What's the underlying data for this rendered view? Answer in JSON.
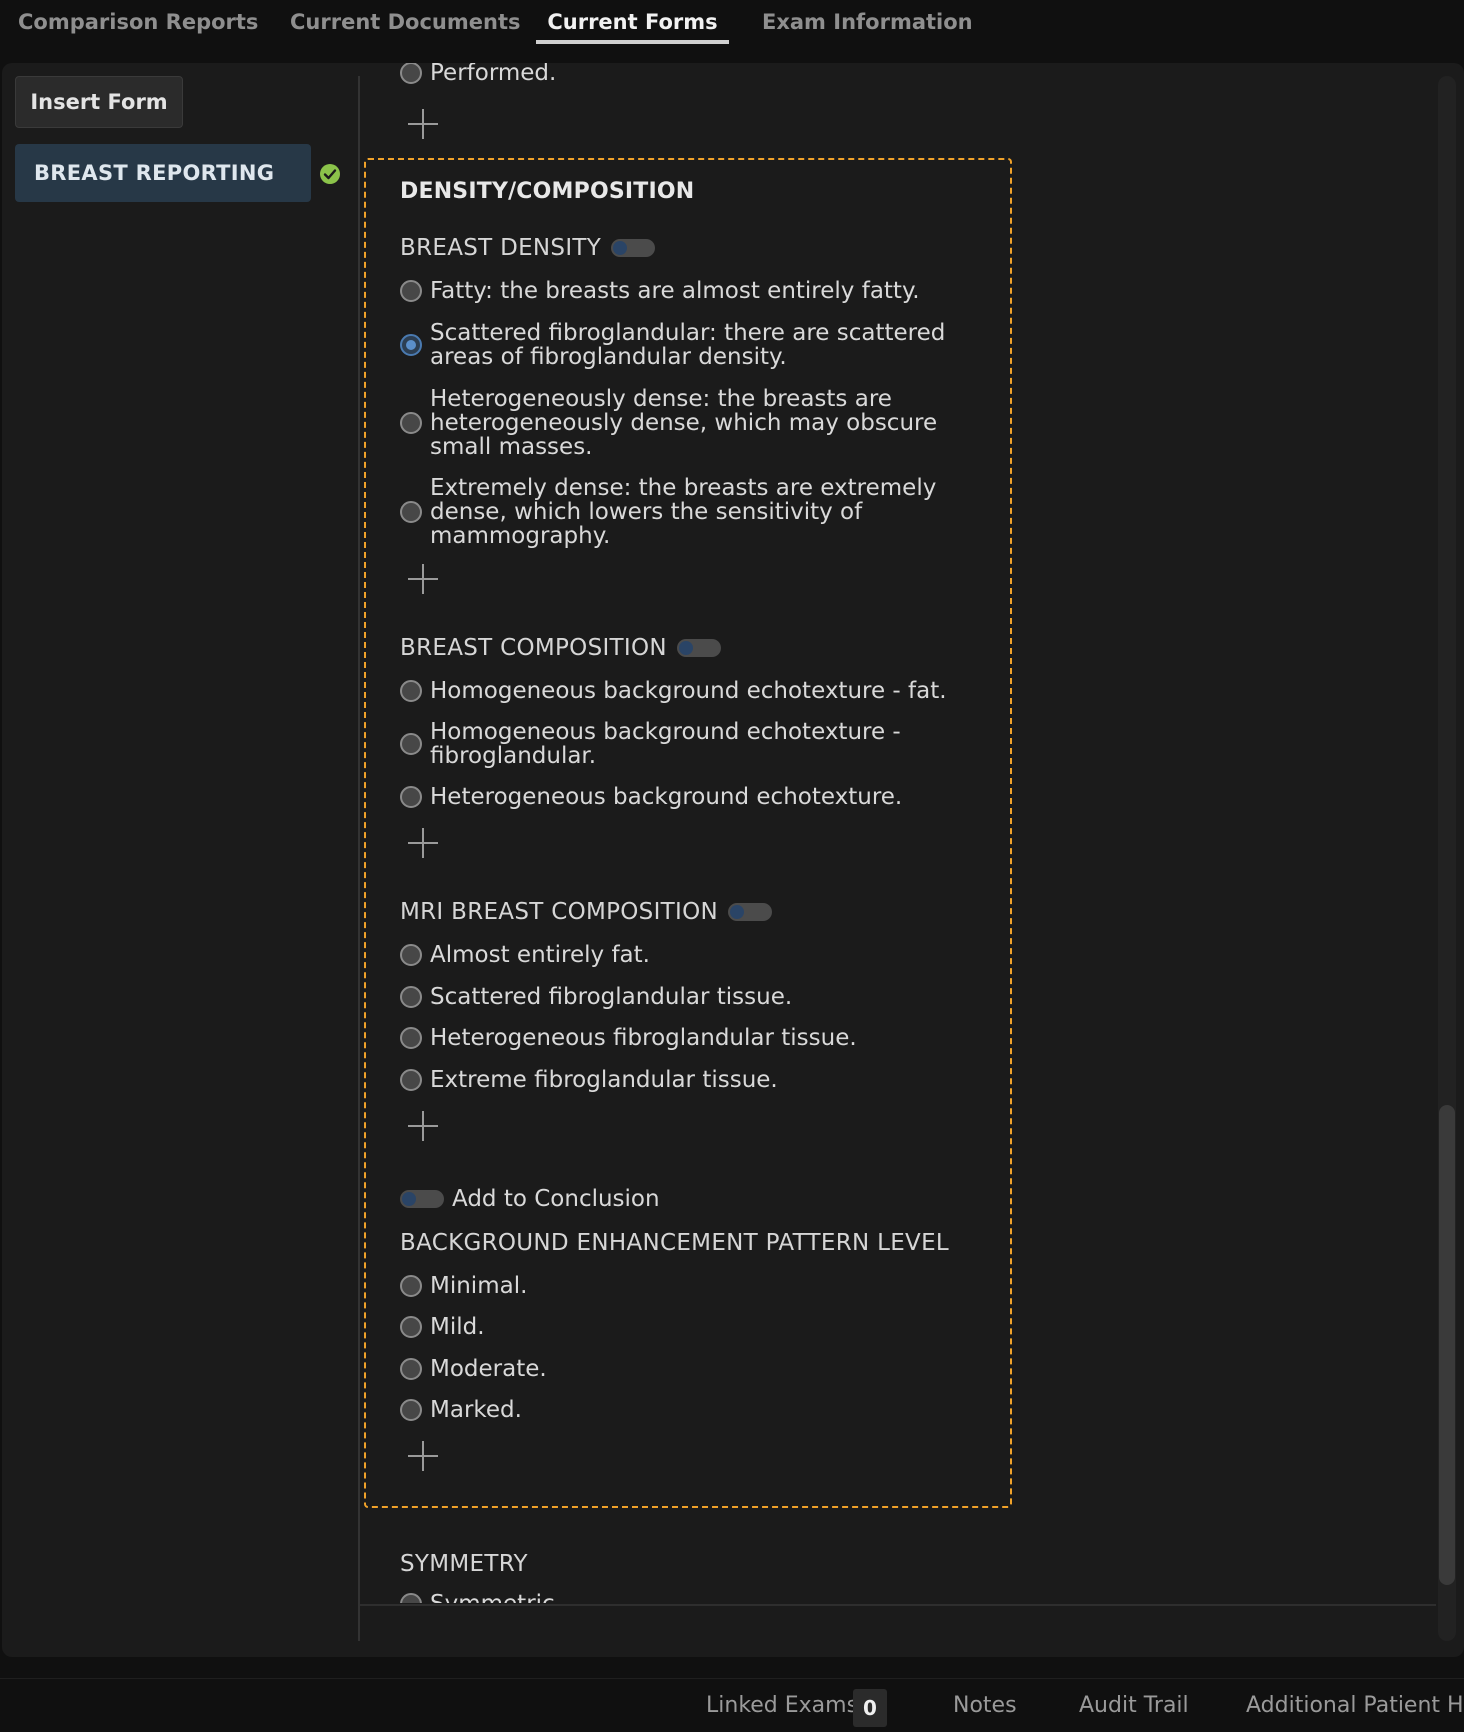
{
  "tabs": [
    {
      "label": "Comparison Reports",
      "active": false
    },
    {
      "label": "Current Documents",
      "active": false
    },
    {
      "label": "Current Forms",
      "active": true
    },
    {
      "label": "Exam Information",
      "active": false
    }
  ],
  "sidebar": {
    "insert_form_label": "Insert Form",
    "forms": [
      {
        "label": "BREAST REPORTING",
        "status": "complete",
        "status_color": "#8bc34a"
      }
    ]
  },
  "form": {
    "top_cut_option": "Performed.",
    "density_section": {
      "title": "DENSITY/COMPOSITION",
      "breast_density": {
        "label": "BREAST DENSITY",
        "options": [
          "Fatty: the breasts are almost entirely fatty.",
          "Scattered fibroglandular: there are scattered areas of fibroglandular density.",
          "Heterogeneously dense: the breasts are heterogeneously dense, which may obscure small masses.",
          "Extremely dense: the breasts are extremely dense, which lowers the sensitivity of mammography."
        ],
        "selected_index": 1
      },
      "breast_composition": {
        "label": "BREAST COMPOSITION",
        "options": [
          "Homogeneous background echotexture - fat.",
          "Homogeneous background echotexture - fibroglandular.",
          "Heterogeneous background echotexture."
        ]
      },
      "mri_breast_composition": {
        "label": "MRI BREAST COMPOSITION",
        "options": [
          "Almost entirely fat.",
          "Scattered fibroglandular tissue.",
          "Heterogeneous fibroglandular tissue.",
          "Extreme fibroglandular tissue."
        ]
      },
      "add_to_conclusion_label": "Add to Conclusion",
      "background_enhancement": {
        "label": "BACKGROUND ENHANCEMENT PATTERN LEVEL",
        "options": [
          "Minimal.",
          "Mild.",
          "Moderate.",
          "Marked."
        ]
      },
      "accent_color": "#f0a22a"
    },
    "symmetry": {
      "label": "SYMMETRY",
      "first_option": "Symmetric"
    }
  },
  "bottom_bar": {
    "linked_exams_label": "Linked Exams",
    "linked_exams_count": "0",
    "notes_label": "Notes",
    "audit_trail_label": "Audit Trail",
    "additional_history_label": "Additional Patient His"
  }
}
